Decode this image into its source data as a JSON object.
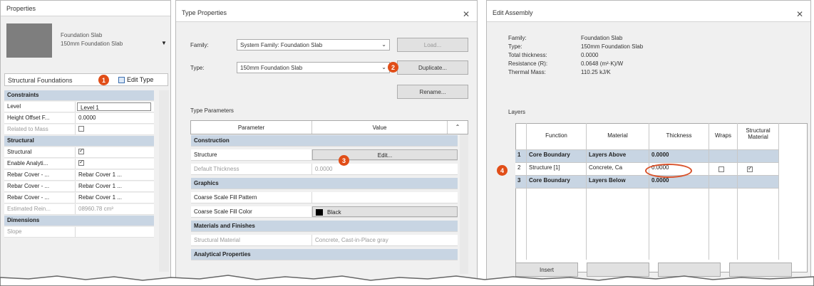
{
  "properties": {
    "title": "Properties",
    "type_name_1": "Foundation Slab",
    "type_name_2": "150mm Foundation Slab",
    "category": "Structural Foundations",
    "edit_type_label": "Edit Type",
    "rows": [
      {
        "kind": "head",
        "c1": "Constraints",
        "c2": ""
      },
      {
        "kind": "row",
        "c1": "Level",
        "c2": "Level 1"
      },
      {
        "kind": "row",
        "c1": "Height Offset F...",
        "c2": "0.0000"
      },
      {
        "kind": "grey",
        "c1": "Related to Mass",
        "c2": ""
      },
      {
        "kind": "head",
        "c1": "Structural",
        "c2": ""
      },
      {
        "kind": "row",
        "c1": "Structural",
        "c2": ""
      },
      {
        "kind": "row",
        "c1": "Enable Analyti...",
        "c2": ""
      },
      {
        "kind": "row",
        "c1": "Rebar Cover - ...",
        "c2": "Rebar Cover 1 ..."
      },
      {
        "kind": "row",
        "c1": "Rebar Cover - ...",
        "c2": "Rebar Cover 1 ..."
      },
      {
        "kind": "row",
        "c1": "Rebar Cover - ...",
        "c2": "Rebar Cover 1 ..."
      },
      {
        "kind": "grey",
        "c1": "Estimated Rein...",
        "c2": "08960.78 cm³"
      },
      {
        "kind": "head",
        "c1": "Dimensions",
        "c2": ""
      },
      {
        "kind": "grey",
        "c1": "Slope",
        "c2": ""
      }
    ]
  },
  "type_props": {
    "title": "Type Properties",
    "family_label": "Family:",
    "family_value": "System Family: Foundation Slab",
    "load_button": "Load...",
    "type_label": "Type:",
    "type_value": "150mm Foundation Slab",
    "duplicate_button": "Duplicate...",
    "rename_button": "Rename...",
    "params_heading": "Type Parameters",
    "col_parameter": "Parameter",
    "col_value": "Value",
    "rows": [
      {
        "kind": "head",
        "c1": "Construction",
        "c2": ""
      },
      {
        "kind": "row",
        "c1": "Structure",
        "c2": "Edit..."
      },
      {
        "kind": "grey",
        "c1": "Default Thickness",
        "c2": "0.0000"
      },
      {
        "kind": "head",
        "c1": "Graphics",
        "c2": ""
      },
      {
        "kind": "row",
        "c1": "Coarse Scale Fill Pattern",
        "c2": ""
      },
      {
        "kind": "row",
        "c1": "Coarse Scale Fill Color",
        "c2": "Black"
      },
      {
        "kind": "head",
        "c1": "Materials and Finishes",
        "c2": ""
      },
      {
        "kind": "grey",
        "c1": "Structural Material",
        "c2": "Concrete, Cast-in-Place gray"
      },
      {
        "kind": "head",
        "c1": "Analytical Properties",
        "c2": ""
      }
    ]
  },
  "assembly": {
    "title": "Edit Assembly",
    "info": [
      {
        "label": "Family:",
        "value": "Foundation Slab"
      },
      {
        "label": "Type:",
        "value": "150mm Foundation Slab"
      },
      {
        "label": "Total thickness:",
        "value": "0.0000"
      },
      {
        "label": "Resistance (R):",
        "value": "0.0648 (m²·K)/W"
      },
      {
        "label": "Thermal Mass:",
        "value": "110.25 kJ/K"
      }
    ],
    "layers_label": "Layers",
    "cols": [
      "Function",
      "Material",
      "Thickness",
      "Wraps",
      "Structural Material"
    ],
    "rows": [
      {
        "num": "1",
        "function": "Core Boundary",
        "material": "Layers Above",
        "thickness": "0.0000",
        "bold": true
      },
      {
        "num": "2",
        "function": "Structure [1]",
        "material": "Concrete, Ca",
        "thickness": "0.0000",
        "bold": false
      },
      {
        "num": "3",
        "function": "Core Boundary",
        "material": "Layers Below",
        "thickness": "0.0000",
        "bold": true
      }
    ],
    "bottom_buttons": [
      "Insert",
      "",
      "",
      ""
    ]
  },
  "badges": [
    "1",
    "2",
    "3",
    "4"
  ],
  "colors": {
    "badge": "#e14e18",
    "section": "#c8d5e3",
    "highlight_ring": "#d9532b"
  }
}
